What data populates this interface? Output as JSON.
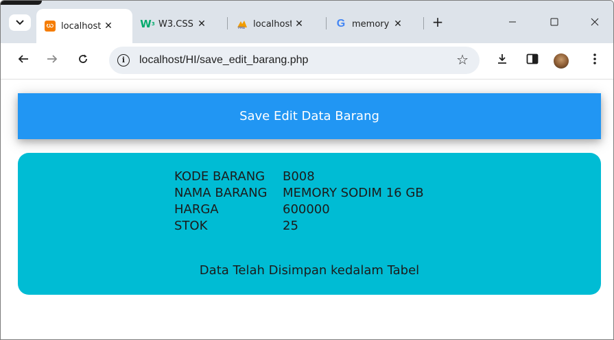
{
  "browser": {
    "tabs": [
      {
        "title": "localhost",
        "favicon": "xampp-icon",
        "color": "#f57c00"
      },
      {
        "title": "W3.CSS",
        "favicon": "w3schools-icon",
        "color": "#04aa6d"
      },
      {
        "title": "localhost",
        "favicon": "phpmyadmin-icon",
        "color": "#f29d00"
      },
      {
        "title": "memory",
        "favicon": "google-icon",
        "color": "#4285f4"
      }
    ],
    "address": "localhost/HI/save_edit_barang.php"
  },
  "page": {
    "header_text": "Save Edit Data Barang",
    "rows": [
      {
        "label": "KODE BARANG",
        "value": "B008"
      },
      {
        "label": "NAMA BARANG",
        "value": "MEMORY SODIM 16 GB"
      },
      {
        "label": "HARGA",
        "value": "600000"
      },
      {
        "label": "STOK",
        "value": "25"
      }
    ],
    "message": "Data Telah Disimpan kedalam Tabel"
  },
  "colors": {
    "header_bg": "#2196f3",
    "card_bg": "#00bcd4",
    "tabstrip_bg": "#dde3ea"
  }
}
